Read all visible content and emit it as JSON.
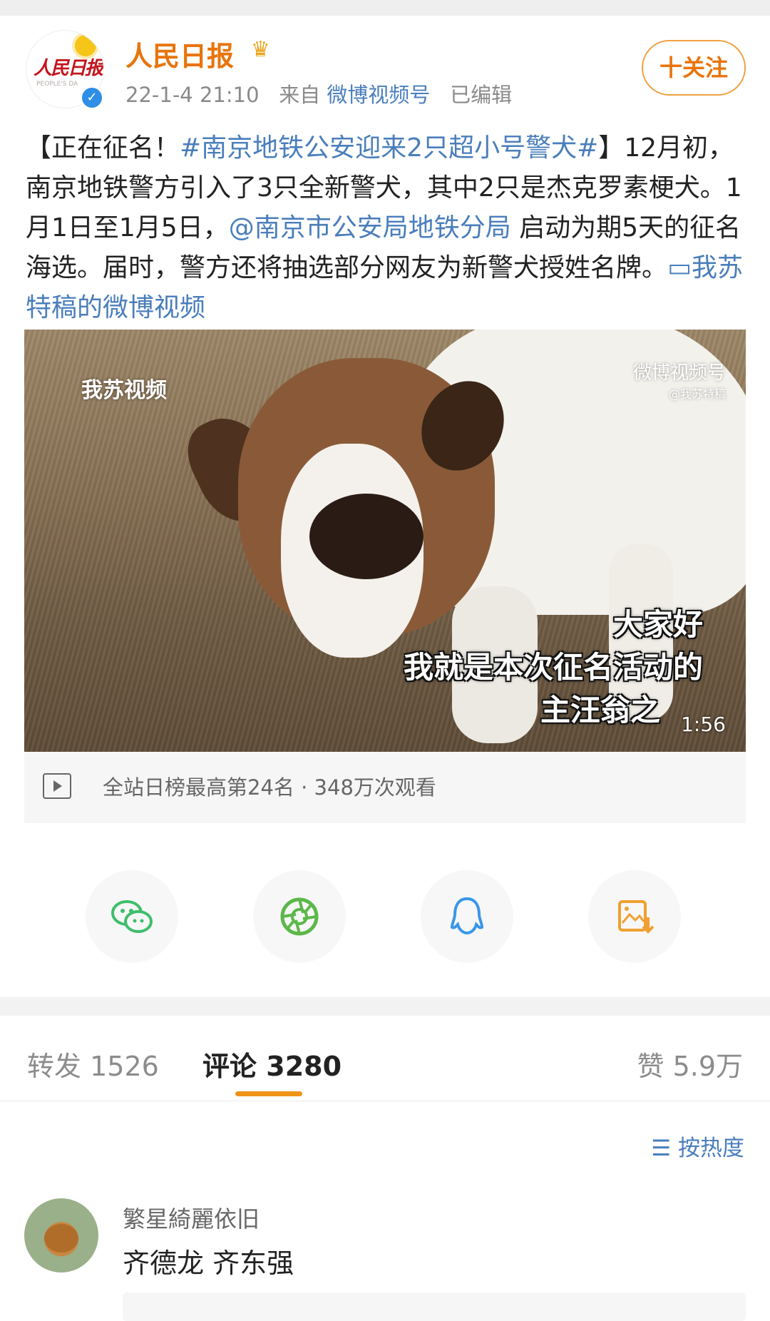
{
  "post": {
    "author": "人民日报",
    "avatar_logo": "人民日报",
    "avatar_sub": "PEOPLE'S DA",
    "crown_icon": "crown-icon",
    "verified_icon": "verified-badge-icon",
    "time": "22-1-4 21:10",
    "from_label": "来自",
    "source": "微博视频号",
    "edited": "已编辑",
    "follow_label": "十关注",
    "text_prefix": "【正在征名！",
    "hashtag": "#南京地铁公安迎来2只超小号警犬#",
    "text_mid": "】12月初，南京地铁警方引入了3只全新警犬，其中2只是杰克罗素梗犬。1月1日至1月5日，",
    "mention": "@南京市公安局地铁分局",
    "text_end": " 启动为期5天的征名海选。届时，警方还将抽选部分网友为新警犬授姓名牌。",
    "video_link": "我苏特稿的微博视频"
  },
  "video": {
    "watermark_left": "我苏视频",
    "watermark_right": "微博视频号",
    "watermark_right_sub": "@我苏特稿",
    "subtitle_1": "大家好",
    "subtitle_2": "我就是本次征名活动的",
    "subtitle_3": "主汪翁之",
    "duration": "1:56"
  },
  "stats": {
    "text": "全站日榜最高第24名 · 348万次观看"
  },
  "share": {
    "wechat_icon": "wechat-icon",
    "moments_icon": "moments-icon",
    "qq_icon": "qq-icon",
    "save_image_icon": "save-image-icon"
  },
  "tabs": {
    "repost_label": "转发",
    "repost_count": "1526",
    "comment_label": "评论",
    "comment_count": "3280",
    "like_label": "赞",
    "like_count": "5.9万"
  },
  "sort_label": "按热度",
  "comments": [
    {
      "user": "繁星綺麗依旧",
      "text": "齐德龙 齐东强"
    }
  ],
  "colors": {
    "accent": "#f09419",
    "link": "#4a7ebb",
    "author": "#e8740c"
  }
}
